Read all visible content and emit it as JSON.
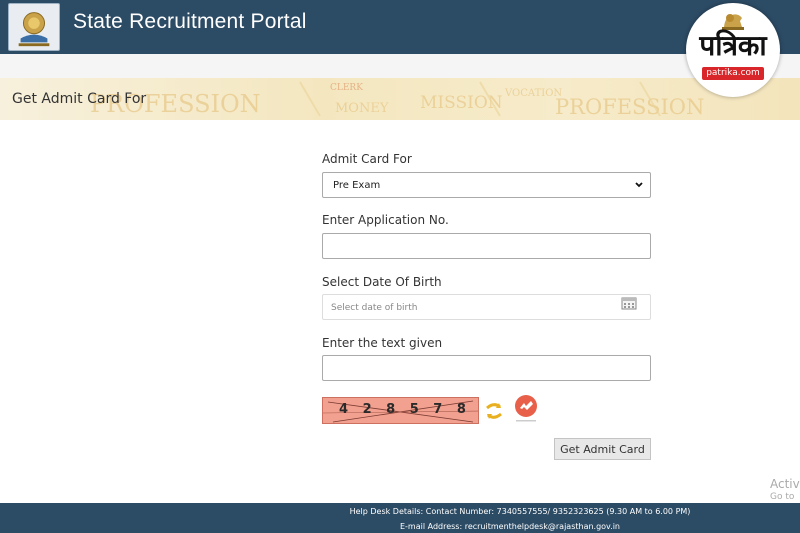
{
  "header": {
    "title": "State Recruitment Portal",
    "logo_icon": "rajasthan-emblem-icon",
    "background": "#2c4b65"
  },
  "banner": {
    "title": "Get Admit Card For",
    "background_words": [
      "PROFESSION",
      "CLERK",
      "MONEY",
      "MISSION",
      "VOCATION",
      "PROFESSION"
    ]
  },
  "form": {
    "admit_card_label": "Admit Card For",
    "admit_card_selected": "Pre Exam",
    "application_label": "Enter Application No.",
    "application_value": "",
    "dob_label": "Select Date Of Birth",
    "dob_placeholder": "Select date of birth",
    "captcha_label": "Enter the text given",
    "captcha_value": "",
    "captcha_text": "4 2 8 5 7 8",
    "submit_label": "Get Admit Card",
    "refresh_icon": "refresh-icon",
    "audio_icon": "audio-captcha-icon"
  },
  "footer": {
    "helpdesk": "Help Desk Details: Contact Number: 7340557555/ 9352323625 (9.30 AM to 6.00 PM)",
    "email": "E-mail Address: recruitmenthelpdesk@rajasthan.gov.in"
  },
  "watermark": {
    "line1": "Activ",
    "line2": "Go to"
  },
  "publisher_badge": {
    "name": "पत्रिका",
    "domain": "patrika.com",
    "accent": "#d8262a"
  }
}
